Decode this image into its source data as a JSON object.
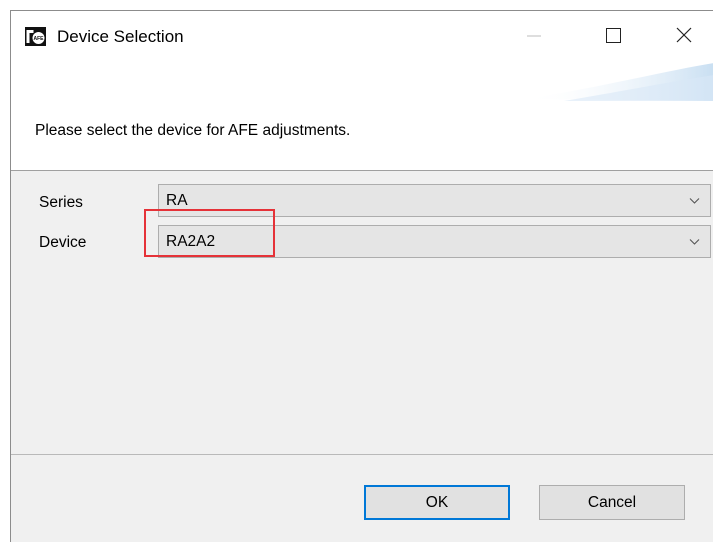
{
  "window": {
    "title": "Device Selection",
    "icon": "afe-app-icon",
    "icon_text": "AFE",
    "controls": [
      "minimize-icon",
      "maximize-icon",
      "close-icon"
    ]
  },
  "message": "Please select the device for AFE adjustments.",
  "form": {
    "series": {
      "label": "Series",
      "value": "RA"
    },
    "device": {
      "label": "Device",
      "value": "RA2A2"
    }
  },
  "buttons": {
    "ok": "OK",
    "cancel": "Cancel"
  },
  "annotation": {
    "color": "#e53238",
    "target": "device-combo-value"
  },
  "colors": {
    "focus_border": "#0078d7",
    "dialog_bg": "#f0f0f0"
  }
}
